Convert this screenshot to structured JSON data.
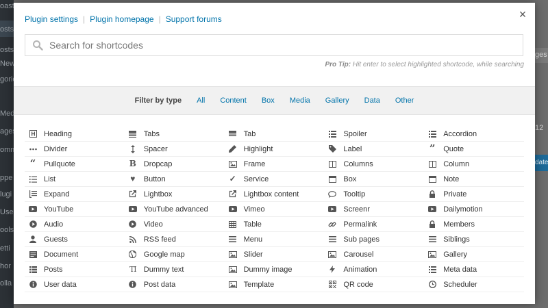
{
  "background": {
    "left_fragments": [
      "oast",
      "osts",
      "osts",
      "New",
      "gorie",
      "Medi",
      "ages",
      "omm",
      "ppe",
      "lugi",
      "Use",
      "ools",
      "etti",
      "hor",
      "olla"
    ],
    "right_fragments": [
      "ges",
      "12"
    ],
    "right_button": "date"
  },
  "modal": {
    "close_icon": "×",
    "nav": {
      "plugin_settings": "Plugin settings",
      "plugin_homepage": "Plugin homepage",
      "support_forums": "Support forums",
      "separator": "|"
    },
    "search": {
      "placeholder": "Search for shortcodes",
      "value": ""
    },
    "protip": {
      "label": "Pro Tip:",
      "text": "Hit enter to select highlighted shortcode, while searching"
    },
    "filter": {
      "label": "Filter by type",
      "types": [
        "All",
        "Content",
        "Box",
        "Media",
        "Gallery",
        "Data",
        "Other"
      ]
    },
    "shortcodes": [
      {
        "label": "Heading",
        "icon": "heading-icon"
      },
      {
        "label": "Tabs",
        "icon": "tabs-icon"
      },
      {
        "label": "Tab",
        "icon": "tab-icon"
      },
      {
        "label": "Spoiler",
        "icon": "spoiler-icon"
      },
      {
        "label": "Accordion",
        "icon": "accordion-icon"
      },
      {
        "label": "Divider",
        "icon": "divider-icon"
      },
      {
        "label": "Spacer",
        "icon": "spacer-icon"
      },
      {
        "label": "Highlight",
        "icon": "highlight-icon"
      },
      {
        "label": "Label",
        "icon": "label-icon"
      },
      {
        "label": "Quote",
        "icon": "quote-icon"
      },
      {
        "label": "Pullquote",
        "icon": "pullquote-icon"
      },
      {
        "label": "Dropcap",
        "icon": "dropcap-icon"
      },
      {
        "label": "Frame",
        "icon": "frame-icon"
      },
      {
        "label": "Columns",
        "icon": "columns-icon"
      },
      {
        "label": "Column",
        "icon": "column-icon"
      },
      {
        "label": "List",
        "icon": "list-icon"
      },
      {
        "label": "Button",
        "icon": "heart-icon"
      },
      {
        "label": "Service",
        "icon": "service-icon"
      },
      {
        "label": "Box",
        "icon": "box-icon"
      },
      {
        "label": "Note",
        "icon": "note-icon"
      },
      {
        "label": "Expand",
        "icon": "expand-icon"
      },
      {
        "label": "Lightbox",
        "icon": "lightbox-icon"
      },
      {
        "label": "Lightbox content",
        "icon": "lightbox-content-icon"
      },
      {
        "label": "Tooltip",
        "icon": "tooltip-icon"
      },
      {
        "label": "Private",
        "icon": "lock-icon"
      },
      {
        "label": "YouTube",
        "icon": "play-icon"
      },
      {
        "label": "YouTube advanced",
        "icon": "play-icon"
      },
      {
        "label": "Vimeo",
        "icon": "play-icon"
      },
      {
        "label": "Screenr",
        "icon": "play-icon"
      },
      {
        "label": "Dailymotion",
        "icon": "play-icon"
      },
      {
        "label": "Audio",
        "icon": "play-circle-icon"
      },
      {
        "label": "Video",
        "icon": "play-circle-icon"
      },
      {
        "label": "Table",
        "icon": "table-icon"
      },
      {
        "label": "Permalink",
        "icon": "link-icon"
      },
      {
        "label": "Members",
        "icon": "lock-icon"
      },
      {
        "label": "Guests",
        "icon": "user-icon"
      },
      {
        "label": "RSS feed",
        "icon": "rss-icon"
      },
      {
        "label": "Menu",
        "icon": "menu-icon"
      },
      {
        "label": "Sub pages",
        "icon": "menu-icon"
      },
      {
        "label": "Siblings",
        "icon": "menu-icon"
      },
      {
        "label": "Document",
        "icon": "document-icon"
      },
      {
        "label": "Google map",
        "icon": "globe-icon"
      },
      {
        "label": "Slider",
        "icon": "image-icon"
      },
      {
        "label": "Carousel",
        "icon": "image-icon"
      },
      {
        "label": "Gallery",
        "icon": "image-icon"
      },
      {
        "label": "Posts",
        "icon": "posts-icon"
      },
      {
        "label": "Dummy text",
        "icon": "text-icon"
      },
      {
        "label": "Dummy image",
        "icon": "image-icon"
      },
      {
        "label": "Animation",
        "icon": "bolt-icon"
      },
      {
        "label": "Meta data",
        "icon": "meta-icon"
      },
      {
        "label": "User data",
        "icon": "info-icon"
      },
      {
        "label": "Post data",
        "icon": "info-icon"
      },
      {
        "label": "Template",
        "icon": "puzzle-icon"
      },
      {
        "label": "QR code",
        "icon": "qrcode-icon"
      },
      {
        "label": "Scheduler",
        "icon": "clock-icon"
      }
    ]
  }
}
